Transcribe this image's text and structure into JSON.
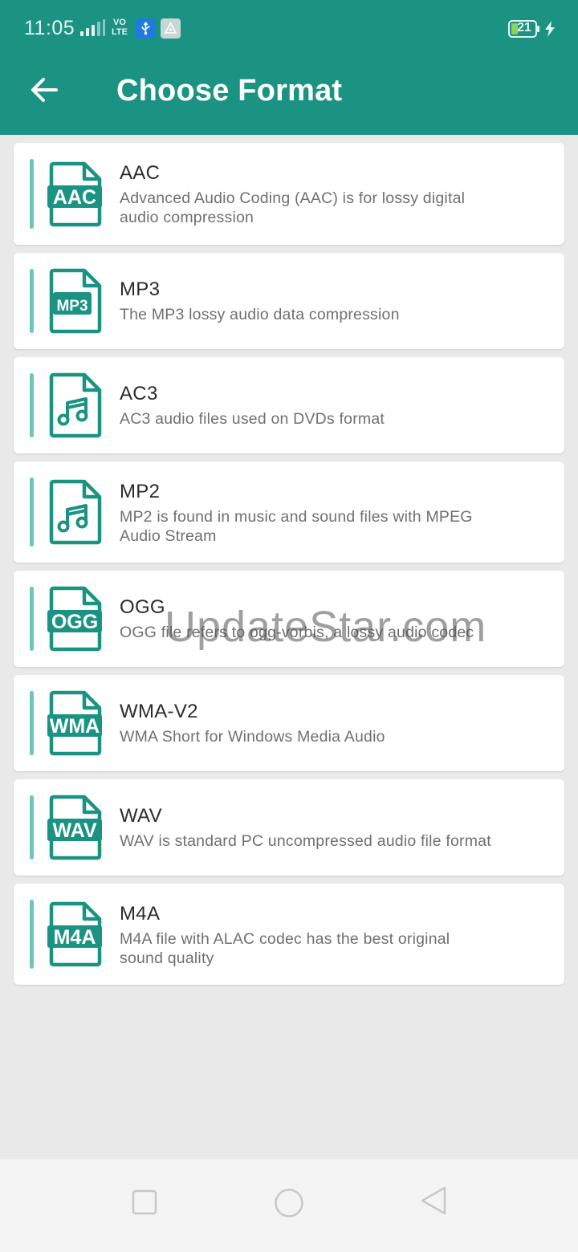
{
  "status_bar": {
    "time": "11:05",
    "volte_line1": "VO",
    "volte_line2": "LTE",
    "battery": "21",
    "icons": [
      "signal-icon",
      "usb-icon",
      "shield-icon",
      "battery-icon",
      "charging-icon"
    ]
  },
  "app_bar": {
    "title": "Choose Format",
    "back_icon": "arrow-left-icon"
  },
  "accent_color": "#1b9383",
  "formats": [
    {
      "name": "AAC",
      "desc_lines": [
        "Advanced Audio Coding (AAC) is for lossy digital",
        "audio compression"
      ],
      "icon_label": "AAC",
      "icon": "aac-file-icon"
    },
    {
      "name": "MP3",
      "desc_lines": [
        "The MP3 lossy audio data compression"
      ],
      "icon_label": "MP3",
      "icon": "mp3-file-icon"
    },
    {
      "name": "AC3",
      "desc_lines": [
        "AC3 audio files used on DVDs format"
      ],
      "icon_label": "",
      "icon": "music-file-icon"
    },
    {
      "name": "MP2",
      "desc_lines": [
        "MP2 is found in music and sound files with MPEG",
        "Audio Stream"
      ],
      "icon_label": "",
      "icon": "music-file-icon"
    },
    {
      "name": "OGG",
      "desc_lines": [
        "OGG file refers to ogg-vorbis, a lossy audio codec"
      ],
      "icon_label": "OGG",
      "icon": "ogg-file-icon"
    },
    {
      "name": "WMA-V2",
      "desc_lines": [
        "WMA Short for Windows Media Audio"
      ],
      "icon_label": "WMA",
      "icon": "wma-file-icon"
    },
    {
      "name": "WAV",
      "desc_lines": [
        "WAV is standard PC uncompressed audio file format"
      ],
      "icon_label": "WAV",
      "icon": "wav-file-icon"
    },
    {
      "name": "M4A",
      "desc_lines": [
        "M4A file with ALAC codec has the best original",
        "sound quality"
      ],
      "icon_label": "M4A",
      "icon": "m4a-file-icon"
    }
  ],
  "watermark": "UpdateStar.com",
  "nav_bar": {
    "icons": [
      "recents-square-icon",
      "home-circle-icon",
      "back-triangle-icon"
    ]
  }
}
